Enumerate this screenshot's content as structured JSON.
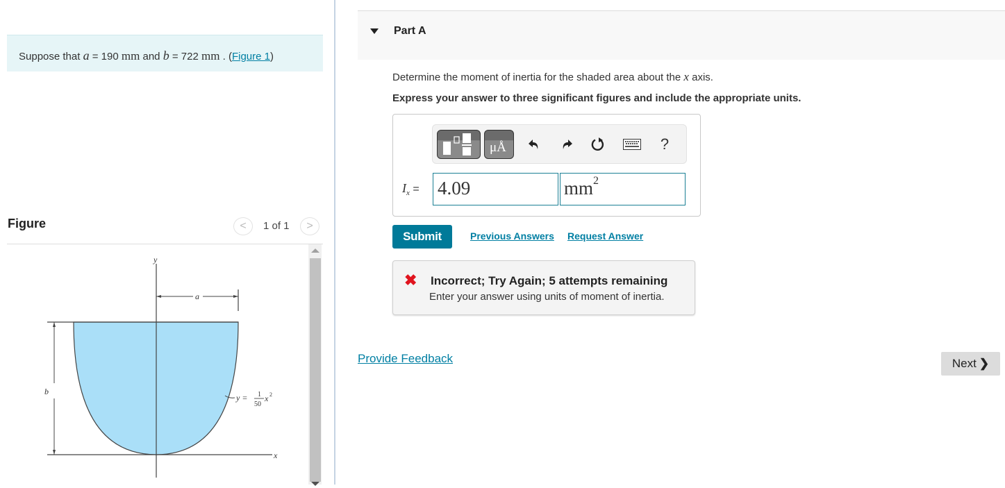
{
  "problem": {
    "prefix": "Suppose that",
    "a_var": "a",
    "a_eq": " = 190 ",
    "a_unit": "mm",
    "and": " and ",
    "b_var": "b",
    "b_eq": " = 722 ",
    "b_unit": "mm",
    "period": " . (",
    "figure_link": "Figure 1",
    "close": ")"
  },
  "figure_panel": {
    "title": "Figure",
    "pager": "1 of 1",
    "prev_icon": "chevron-left-icon",
    "next_icon": "chevron-right-icon",
    "labels": {
      "y_axis": "y",
      "x_axis": "x",
      "dim_a": "a",
      "dim_b": "b",
      "eq_lhs": "y =",
      "eq_num": "1",
      "eq_den": "50",
      "eq_rhs": "x",
      "eq_exp": "2"
    },
    "colors": {
      "fill": "#aadff8",
      "stroke": "#333333"
    }
  },
  "part": {
    "title": "Part A",
    "question_prefix": "Determine the moment of inertia for the shaded area about the ",
    "question_var": "x",
    "question_suffix": " axis.",
    "instructions": "Express your answer to three significant figures and include the appropriate units."
  },
  "toolbar": {
    "templates_icon": "templates-icon",
    "units_label": "μÅ",
    "undo_icon": "undo-icon",
    "redo_icon": "redo-icon",
    "reset_icon": "reset-icon",
    "keyboard_icon": "keyboard-icon",
    "help_label": "?"
  },
  "answer": {
    "label_var": "I",
    "label_sub": "x",
    "label_eq": " =",
    "value": "4.09",
    "unit_base": "mm",
    "unit_exp": "2"
  },
  "actions": {
    "submit": "Submit",
    "previous_answers": "Previous Answers",
    "request_answer": "Request Answer"
  },
  "feedback": {
    "icon": "✖",
    "title": "Incorrect; Try Again; 5 attempts remaining",
    "message": "Enter your answer using units of moment of inertia."
  },
  "footer": {
    "provide_feedback": "Provide Feedback",
    "next": "Next",
    "next_icon": "❯"
  },
  "colors": {
    "accent": "#007a99",
    "link": "#007fa3",
    "error": "#e0141e",
    "problem_bg": "#e6f5f7"
  }
}
